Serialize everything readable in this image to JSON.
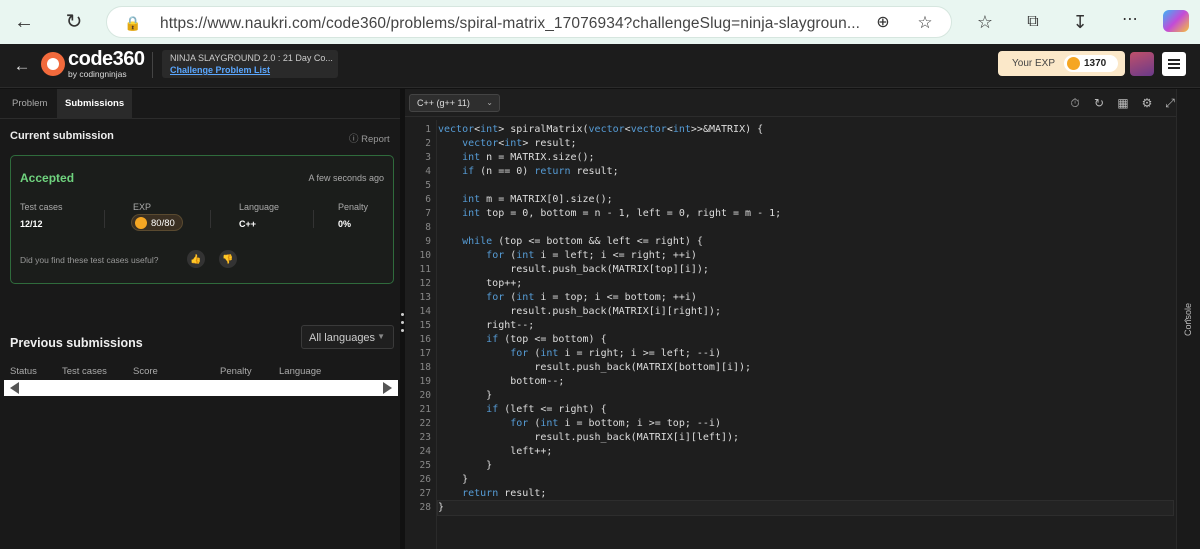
{
  "browser": {
    "url": "https://www.naukri.com/code360/problems/spiral-matrix_17076934?challengeSlug=ninja-slaygroun...",
    "icons": [
      "back-arrow-icon",
      "refresh-icon",
      "lock-icon",
      "zoom-icon",
      "star-icon",
      "favorites-icon",
      "collections-icon",
      "download-icon",
      "more-icon",
      "copilot-icon"
    ]
  },
  "app_header": {
    "logo_main": "code360",
    "logo_sub": "by codingninjas",
    "contest_name": "NINJA SLAYGROUND 2.0 : 21 Day Co...",
    "contest_link": "Challenge Problem List",
    "exp_label": "Your EXP",
    "exp_value": "1370"
  },
  "left_panel": {
    "tabs": [
      "Problem",
      "Submissions"
    ],
    "active_tab": "Submissions",
    "current_submission_title": "Current submission",
    "report_label": "Report",
    "result": {
      "status": "Accepted",
      "time": "A few seconds ago",
      "test_cases_label": "Test cases",
      "test_cases_value": "12/12",
      "exp_label": "EXP",
      "exp_value": "80/80",
      "language_label": "Language",
      "language_value": "C++",
      "penalty_label": "Penalty",
      "penalty_value": "0%",
      "feedback_question": "Did you find these test cases useful?"
    },
    "previous_title": "Previous submissions",
    "language_filter": "All languages",
    "table_headers": [
      "Status",
      "Test cases",
      "Score",
      "Penalty",
      "Language"
    ]
  },
  "editor": {
    "compiler": "C++ (g++ 11)",
    "lines": [
      "vector<int> spiralMatrix(vector<vector<int>>&MATRIX) {",
      "    vector<int> result;",
      "    int n = MATRIX.size();",
      "    if (n == 0) return result;",
      "",
      "    int m = MATRIX[0].size();",
      "    int top = 0, bottom = n - 1, left = 0, right = m - 1;",
      "",
      "    while (top <= bottom && left <= right) {",
      "        for (int i = left; i <= right; ++i)",
      "            result.push_back(MATRIX[top][i]);",
      "        top++;",
      "        for (int i = top; i <= bottom; ++i)",
      "            result.push_back(MATRIX[i][right]);",
      "        right--;",
      "        if (top <= bottom) {",
      "            for (int i = right; i >= left; --i)",
      "                result.push_back(MATRIX[bottom][i]);",
      "            bottom--;",
      "        }",
      "        if (left <= right) {",
      "            for (int i = bottom; i >= top; --i)",
      "                result.push_back(MATRIX[i][left]);",
      "            left++;",
      "        }",
      "    }",
      "    return result;",
      "}"
    ],
    "console_label": "Console"
  }
}
